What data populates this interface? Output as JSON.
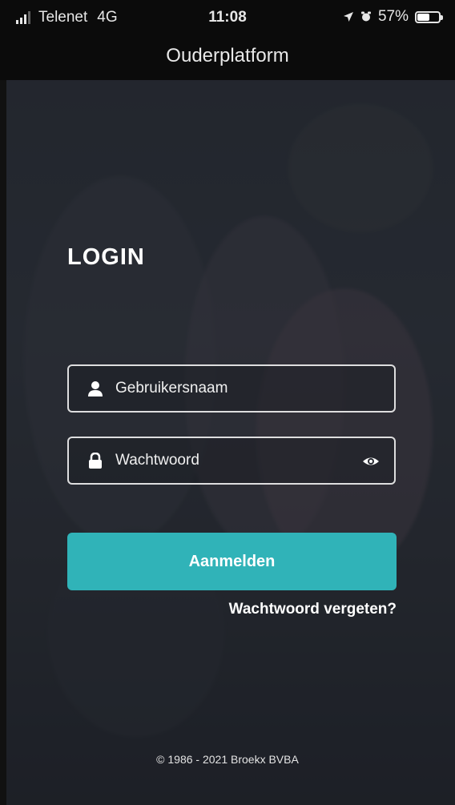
{
  "status_bar": {
    "carrier": "Telenet",
    "network": "4G",
    "time": "11:08",
    "battery_percent": "57%",
    "battery_level": 0.57
  },
  "nav": {
    "title": "Ouderplatform"
  },
  "login": {
    "heading": "LOGIN",
    "username_placeholder": "Gebruikersnaam",
    "password_placeholder": "Wachtwoord",
    "submit_label": "Aanmelden",
    "forgot_link": "Wachtwoord vergeten?"
  },
  "footer": {
    "copyright": "© 1986 - 2021 Broekx BVBA"
  },
  "colors": {
    "accent": "#30b3b8",
    "bar_background": "#0b0b0b",
    "text": "#ffffff"
  },
  "icons": {
    "username": "user-icon",
    "password": "lock-icon",
    "toggle_password": "eye-icon"
  }
}
